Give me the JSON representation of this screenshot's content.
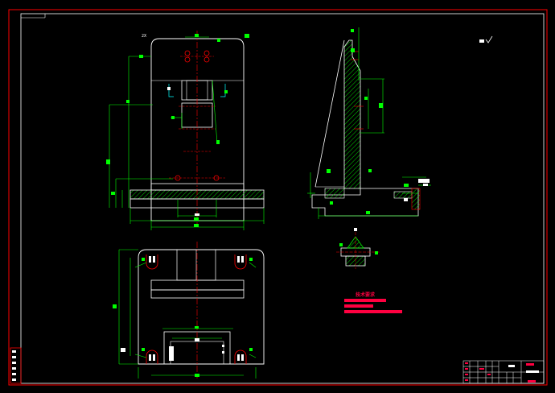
{
  "drawing": {
    "colors": {
      "background": "#000000",
      "outline": "#ffffff",
      "dimension": "#00ff00",
      "centerline": "#ff0000",
      "hatch": "#00ff00",
      "border": "#ff0000",
      "notes": "#ff0040",
      "title_block": "#ffffff"
    },
    "notes_block_heading": "技术要求"
  }
}
